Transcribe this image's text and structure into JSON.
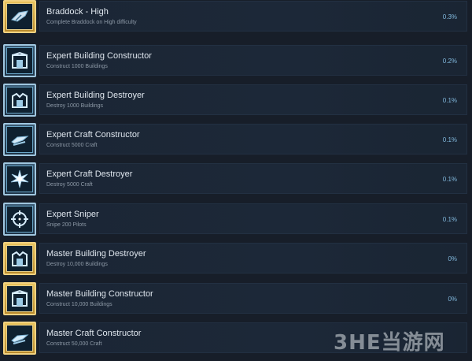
{
  "achievements": [
    {
      "name": "Braddock - High",
      "description": "Complete Braddock on High difficulty",
      "percent": "0.3%",
      "icon": "ship-icon",
      "frame": "gold"
    },
    {
      "name": "Expert Building Constructor",
      "description": "Construct 1000 Buildings",
      "percent": "0.2%",
      "icon": "building-construct-icon",
      "frame": "blue"
    },
    {
      "name": "Expert Building Destroyer",
      "description": "Destroy 1000 Buildings",
      "percent": "0.1%",
      "icon": "building-destroy-icon",
      "frame": "blue"
    },
    {
      "name": "Expert Craft Constructor",
      "description": "Construct 5000 Craft",
      "percent": "0.1%",
      "icon": "craft-icon",
      "frame": "blue"
    },
    {
      "name": "Expert Craft Destroyer",
      "description": "Destroy 5000 Craft",
      "percent": "0.1%",
      "icon": "explosion-icon",
      "frame": "blue"
    },
    {
      "name": "Expert Sniper",
      "description": "Snipe 200 Pilots",
      "percent": "0.1%",
      "icon": "crosshair-icon",
      "frame": "blue"
    },
    {
      "name": "Master Building Destroyer",
      "description": "Destroy 10,000 Buildings",
      "percent": "0%",
      "icon": "building-destroy-icon",
      "frame": "gold"
    },
    {
      "name": "Master Building Constructor",
      "description": "Construct 10,000 Buildings",
      "percent": "0%",
      "icon": "building-construct-icon",
      "frame": "gold"
    },
    {
      "name": "Master Craft Constructor",
      "description": "Construct 50,000 Craft",
      "percent": "",
      "icon": "craft-icon",
      "frame": "gold"
    }
  ],
  "watermark": "3HE当游网"
}
